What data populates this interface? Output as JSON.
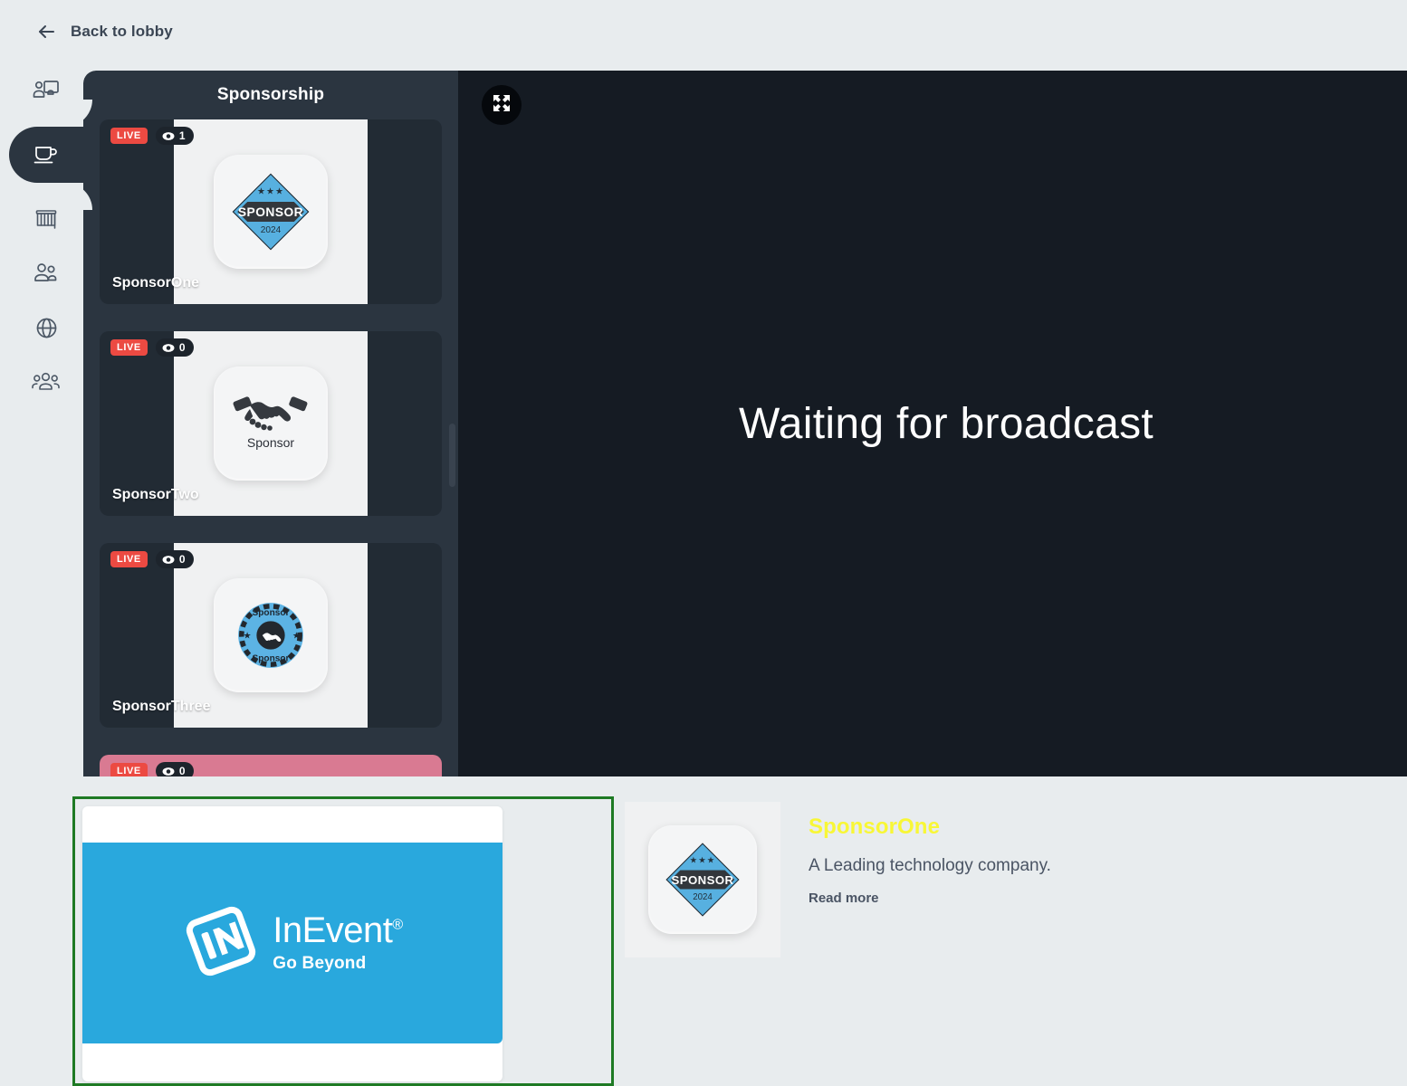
{
  "topbar": {
    "back_label": "Back to lobby",
    "back_icon": "arrow-left-icon"
  },
  "rail": {
    "items": [
      {
        "icon": "presenter-screen-icon",
        "name": "sessions",
        "active": false
      },
      {
        "icon": "coffee-cup-icon",
        "name": "networking-lounge",
        "active": true
      },
      {
        "icon": "booth-stand-icon",
        "name": "exhibition-booths",
        "active": false
      },
      {
        "icon": "two-people-icon",
        "name": "attendees",
        "active": false
      },
      {
        "icon": "globe-icon",
        "name": "global",
        "active": false
      },
      {
        "icon": "group-people-icon",
        "name": "groups",
        "active": false
      }
    ]
  },
  "sponsors_panel": {
    "title": "Sponsorship",
    "cards": [
      {
        "name": "SponsorOne",
        "live_label": "LIVE",
        "views": "1",
        "logo": "sponsor-diamond-badge",
        "rose": false
      },
      {
        "name": "SponsorTwo",
        "live_label": "LIVE",
        "views": "0",
        "logo": "sponsor-handshake",
        "rose": false
      },
      {
        "name": "SponsorThree",
        "live_label": "LIVE",
        "views": "0",
        "logo": "sponsor-seal-badge",
        "rose": false
      },
      {
        "name": "",
        "live_label": "LIVE",
        "views": "0",
        "logo": "",
        "rose": true
      }
    ],
    "views_icon": "eye-icon"
  },
  "broadcast": {
    "message": "Waiting for broadcast",
    "expand_icon": "fullscreen-expand-icon"
  },
  "bottom": {
    "banner": {
      "brand": "InEvent",
      "registered_mark": "®",
      "tagline": "Go Beyond",
      "logo_icon": "inevent-logo-icon",
      "highlight_color": "#1e7a24"
    },
    "detail": {
      "logo": "sponsor-diamond-badge",
      "name": "SponsorOne",
      "description": "A Leading technology company.",
      "read_more": "Read more",
      "name_color": "#f8f736"
    }
  },
  "logo_text": {
    "sponsor_word": "SPONSOR",
    "year": "2024",
    "sponsor_caps": "Sponsor",
    "seal_top": "Sponsor",
    "seal_bottom": "Sponsor"
  },
  "colors": {
    "page_bg": "#e8ecee",
    "panel_bg": "#2b3540",
    "card_bg": "#222b34",
    "broadcast_bg": "#151b23",
    "live_red": "#ec4a42",
    "rose": "#d97a92",
    "brand_blue": "#29a8dd"
  }
}
